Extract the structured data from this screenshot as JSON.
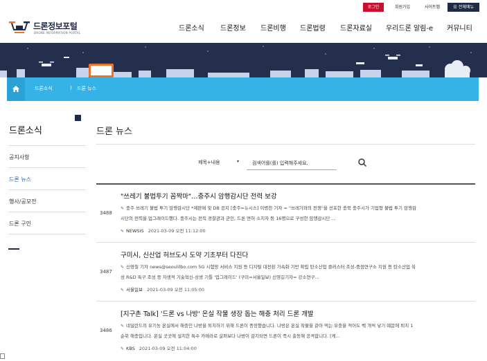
{
  "util": {
    "login": "로그인",
    "join": "회원가입",
    "sitemap": "사이트맵",
    "all_menu": "전체메뉴"
  },
  "logo": {
    "name": "드론정보포털",
    "sub": "DRONE INFORMATION PORTAL"
  },
  "gnb": [
    "드론소식",
    "드론정보",
    "드론비행",
    "드론법령",
    "드론자료실",
    "우리드론 알림-e",
    "커뮤니티"
  ],
  "breadcrumb": {
    "level1": "드론소식",
    "sep": ")",
    "level2": "드론 뉴스"
  },
  "sidebar": {
    "title": "드론소식",
    "items": [
      "공지사항",
      "드론 뉴스",
      "행사/공모전",
      "드론 구인"
    ],
    "active_index": 1
  },
  "page_title": "드론 뉴스",
  "search": {
    "select_value": "제목+내용",
    "placeholder": "검색어를(를) 입력해주세요."
  },
  "news": [
    {
      "num": "3488",
      "title": "\"쓰레기 불법투기 꼼짝마\"…충주시 암행감시단 전력 보강",
      "body_line1": "충주 쓰레기 불법 투기 암행감시단 *제판매 및 DB 공지 [충주=뉴시스] 이병찬 기자 = \"쓰레기와의 전쟁\"을 선포한 충북 충주시가 기업형 불법 투기 암행감",
      "body_line2": "시단의 전력을 업그레이드했다. 충주시는 전직 경찰관과 군인, 드론 면허 소지자 등 16명으로 구성한 암행감시단 ...",
      "source": "NEWSIS",
      "date": "2021-03-09 오전 11:12:00"
    },
    {
      "num": "3487",
      "title": "구미시, 신산업 허브도시 도약 기초부터 다진다",
      "body_line1": "신영철 기자 news@seoulilbo.com 5G 시험망 서비스 지원 등 디지털 대전환 가속화 기반 확립 탄소산업 클러스터 조성-중점연구소 지원 등 탄소산업 육",
      "body_line2": "성 R&D 특구 조성 등 자생적 기술혁신-상생 기틀 '업그레이드' (구미=서울일보) 신영길기자= 강소연구...",
      "source": "서울일보",
      "date": "2021-03-09 오전 11:05:00"
    },
    {
      "num": "3486",
      "title": "[지구촌 Talk] '드론 vs 나방' 온실 작물 생장 돕는 해충 처리 드론 개발",
      "body_line1": "네덜란드의 유기농 온실에서 해충인 나방을 퇴치하기 위해 드론이 증장했습니다. 나방은 온실 작물을 갉아 먹는 유충을 적어도 백 개씩 낳기 때문에 퇴치 1",
      "body_line2": "순위 해충입니다. 온실 곳곳에 설치한 특수 카메라로 살펴보다 나방이 감지되면 드론이 즉시 출동해 공격합니다. [케...",
      "source": "KBS",
      "date": "2021-03-09 오전 11:04:00"
    }
  ]
}
